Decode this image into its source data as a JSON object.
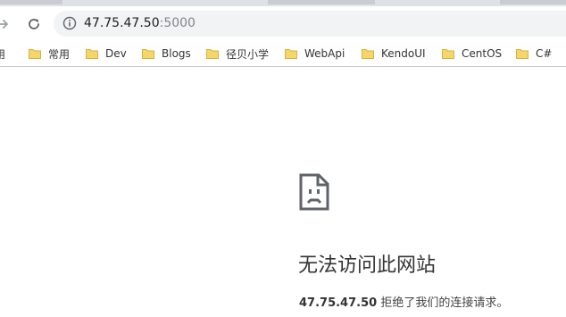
{
  "browser": {
    "address_bar": {
      "host": "47.75.47.50",
      "port": ":5000"
    },
    "icons": {
      "back": "arrow-right-icon",
      "reload": "reload-icon",
      "site_info": "info-icon"
    }
  },
  "bookmarks_bar": {
    "items": [
      {
        "label": "用"
      },
      {
        "label": "常用"
      },
      {
        "label": "Dev"
      },
      {
        "label": "Blogs"
      },
      {
        "label": "径贝小学"
      },
      {
        "label": "WebApi"
      },
      {
        "label": "KendoUI"
      },
      {
        "label": "CentOS"
      },
      {
        "label": "C#"
      }
    ]
  },
  "error_page": {
    "title": "无法访问此网站",
    "host": "47.75.47.50",
    "message": "拒绝了我们的连接请求。"
  },
  "colors": {
    "folder": "#f5d66a",
    "omnibox": "#f1f3f4"
  }
}
